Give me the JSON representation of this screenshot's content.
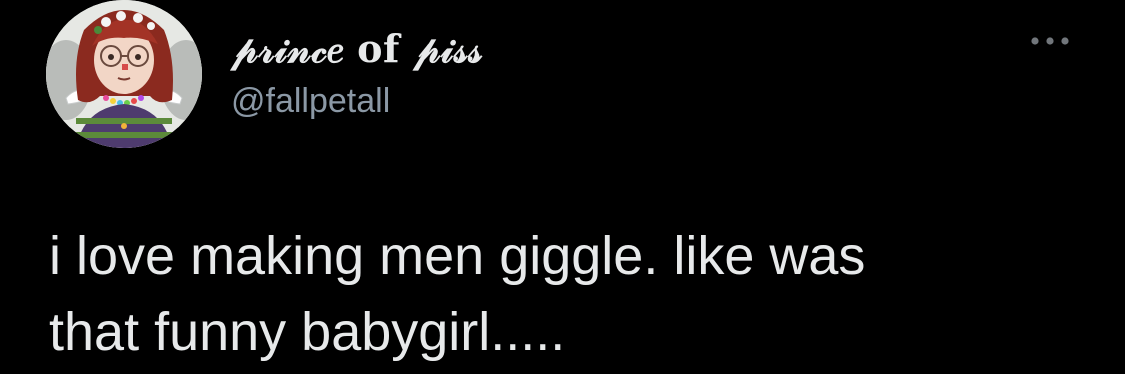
{
  "tweet": {
    "author": {
      "display_name": "𝓅𝓇𝒾𝓃𝒸𝑒 of 𝓅𝒾𝓈𝓈",
      "handle": "@fallpetall"
    },
    "text_lines": [
      "i love making men giggle. like was",
      "that funny babygirl....."
    ],
    "more_icon": "more-horizontal-icon"
  },
  "colors": {
    "background": "#000000",
    "primary_text": "#e7e9ea",
    "secondary_text": "#8b98a5"
  }
}
